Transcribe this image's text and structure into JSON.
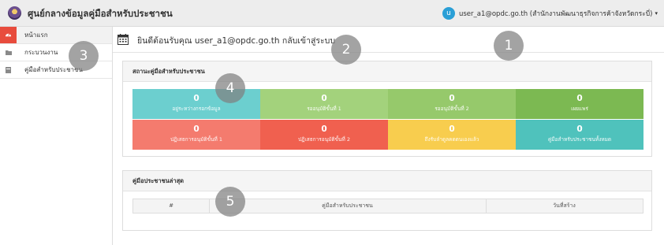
{
  "header": {
    "title": "ศูนย์กลางข้อมูลคู่มือสำหรับประชาชน",
    "user_initial": "u",
    "user_label": "user_a1@opdc.go.th (สำนักงานพัฒนาธุรกิจการค้าจังหวัดกระบี่)",
    "caret": "▾"
  },
  "sidebar": {
    "items": [
      {
        "label": "หน้าแรก",
        "icon": "dashboard-icon",
        "active": true
      },
      {
        "label": "กระบวนงาน",
        "icon": "folder-icon",
        "active": false
      },
      {
        "label": "คู่มือสำหรับประชาชน",
        "icon": "book-icon",
        "active": false
      }
    ]
  },
  "welcome": {
    "text": "ยินดีต้อนรับคุณ user_a1@opdc.go.th กลับเข้าสู่ระบบ",
    "icon": "calendar-icon"
  },
  "status": {
    "title": "สถานะคู่มือสำหรับประชาชน",
    "cards": [
      {
        "value": "0",
        "label": "อยู่ระหว่างกรอกข้อมูล",
        "color": "#6ccfcf"
      },
      {
        "value": "0",
        "label": "รออนุมัติขั้นที่ 1",
        "color": "#a3d27c"
      },
      {
        "value": "0",
        "label": "รออนุมัติขั้นที่ 2",
        "color": "#96c96b"
      },
      {
        "value": "0",
        "label": "เผยแพร่",
        "color": "#7cb952"
      },
      {
        "value": "0",
        "label": "ปฏิเสธการอนุมัติขั้นที่ 1",
        "color": "#f47b6e"
      },
      {
        "value": "0",
        "label": "ปฏิเสธการอนุมัติขั้นที่ 2",
        "color": "#f0604f"
      },
      {
        "value": "0",
        "label": "ถึงรับลำดูลคดตนเองแล้ว",
        "color": "#f8cd4e"
      },
      {
        "value": "0",
        "label": "คู่มือสำหรับประชาชนทั้งหมด",
        "color": "#4fc2bc"
      }
    ]
  },
  "recent": {
    "title": "คู่มือประชาชนล่าสุด",
    "columns": [
      "#",
      "คู่มือสำหรับประชาชน",
      "วันที่สร้าง"
    ]
  },
  "markers": [
    "1",
    "2",
    "3",
    "4",
    "5"
  ],
  "colors": {
    "accent": "#e84c3d",
    "avatar": "#2a9fd6"
  }
}
